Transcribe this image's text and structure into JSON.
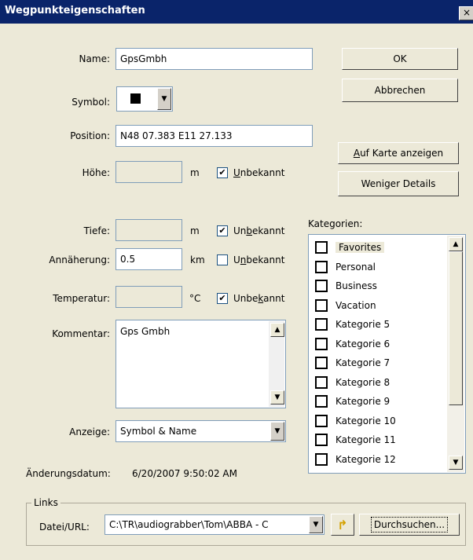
{
  "window": {
    "title": "Wegpunkteigenschaften",
    "close_glyph": "×"
  },
  "labels": {
    "name": "Name:",
    "symbol": "Symbol:",
    "position": "Position:",
    "hoehe": "Höhe:",
    "tiefe": "Tiefe:",
    "annaeherung": "Annäherung:",
    "temperatur": "Temperatur:",
    "kommentar": "Kommentar:",
    "anzeige": "Anzeige:",
    "aenderungsdatum": "Änderungsdatum:",
    "kategorien": "Kategorien:"
  },
  "fields": {
    "name": "GpsGmbh",
    "position": "N48 07.383 E11 27.133",
    "hoehe": "",
    "tiefe": "",
    "annaeherung": "0.5",
    "temperatur": "",
    "kommentar": "Gps Gmbh",
    "anzeige": "Symbol & Name",
    "aenderungsdatum": "6/20/2007 9:50:02 AM",
    "datei_url": "C:\\TR\\audiograbber\\Tom\\ABBA - C"
  },
  "units": {
    "hoehe": "m",
    "tiefe": "m",
    "annaeherung": "km",
    "temperatur": "°C"
  },
  "unbekannt": {
    "hoehe": {
      "pre": "",
      "key": "U",
      "post": "nbekannt",
      "checked": true,
      "mark": "✔"
    },
    "tiefe": {
      "pre": "Un",
      "key": "b",
      "post": "ekannt",
      "checked": true,
      "mark": "✔"
    },
    "annaeherung": {
      "pre": "U",
      "key": "n",
      "post": "bekannt",
      "checked": false,
      "mark": ""
    },
    "temperatur": {
      "pre": "Unbe",
      "key": "k",
      "post": "annt",
      "checked": true,
      "mark": "✔"
    }
  },
  "buttons": {
    "ok": "OK",
    "abbrechen": "Abbrechen",
    "auf_karte_key": "A",
    "auf_karte_rest": "uf Karte anzeigen",
    "weniger_details": "Weniger Details",
    "durchsuchen": "Durchsuchen..."
  },
  "kategorien": [
    {
      "label": "Favorites",
      "checked": false,
      "selected": true
    },
    {
      "label": "Personal",
      "checked": false,
      "selected": false
    },
    {
      "label": "Business",
      "checked": false,
      "selected": false
    },
    {
      "label": "Vacation",
      "checked": false,
      "selected": false
    },
    {
      "label": "Kategorie 5",
      "checked": false,
      "selected": false
    },
    {
      "label": "Kategorie 6",
      "checked": false,
      "selected": false
    },
    {
      "label": "Kategorie 7",
      "checked": false,
      "selected": false
    },
    {
      "label": "Kategorie 8",
      "checked": false,
      "selected": false
    },
    {
      "label": "Kategorie 9",
      "checked": false,
      "selected": false
    },
    {
      "label": "Kategorie 10",
      "checked": false,
      "selected": false
    },
    {
      "label": "Kategorie 11",
      "checked": false,
      "selected": false
    },
    {
      "label": "Kategorie 12",
      "checked": false,
      "selected": false
    }
  ],
  "links": {
    "group_label": "Links",
    "datei_url_label": "Datei/URL:"
  },
  "icons": {
    "symbol": "black-square-icon",
    "open_folder": "open-arrow-icon",
    "dropdown": "triangle-down-icon"
  },
  "colors": {
    "titlebar": "#0a246a",
    "dialog_bg": "#ece9d8",
    "field_border": "#7f9db9"
  }
}
